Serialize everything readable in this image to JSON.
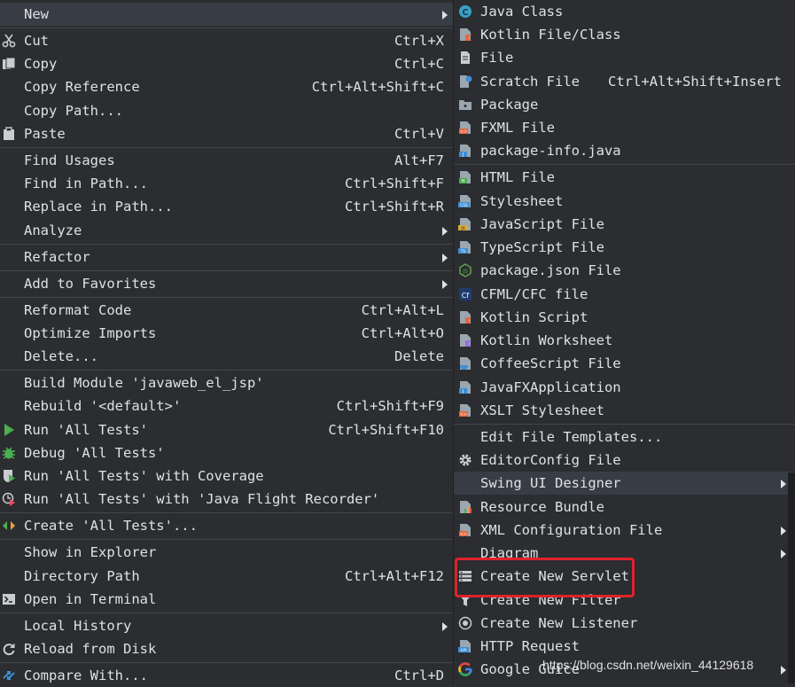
{
  "left_menu": {
    "new": {
      "label": "New"
    },
    "cut": {
      "label": "Cut",
      "shortcut": "Ctrl+X"
    },
    "copy": {
      "label": "Copy",
      "shortcut": "Ctrl+C"
    },
    "copy_reference": {
      "label": "Copy Reference",
      "shortcut": "Ctrl+Alt+Shift+C"
    },
    "copy_path": {
      "label": "Copy Path..."
    },
    "paste": {
      "label": "Paste",
      "shortcut": "Ctrl+V"
    },
    "find_usages": {
      "label": "Find Usages",
      "shortcut": "Alt+F7"
    },
    "find_in_path": {
      "label": "Find in Path...",
      "shortcut": "Ctrl+Shift+F"
    },
    "replace_in_path": {
      "label": "Replace in Path...",
      "shortcut": "Ctrl+Shift+R"
    },
    "analyze": {
      "label": "Analyze"
    },
    "refactor": {
      "label": "Refactor"
    },
    "add_to_favorites": {
      "label": "Add to Favorites"
    },
    "reformat_code": {
      "label": "Reformat Code",
      "shortcut": "Ctrl+Alt+L"
    },
    "optimize_imports": {
      "label": "Optimize Imports",
      "shortcut": "Ctrl+Alt+O"
    },
    "delete": {
      "label": "Delete...",
      "shortcut": "Delete"
    },
    "build_module": {
      "label": "Build Module 'javaweb_el_jsp'"
    },
    "rebuild": {
      "label": "Rebuild '<default>'",
      "shortcut": "Ctrl+Shift+F9"
    },
    "run_tests": {
      "label": "Run 'All Tests'",
      "shortcut": "Ctrl+Shift+F10"
    },
    "debug_tests": {
      "label": "Debug 'All Tests'"
    },
    "run_coverage": {
      "label": "Run 'All Tests' with Coverage"
    },
    "run_jfr": {
      "label": "Run 'All Tests' with 'Java Flight Recorder'"
    },
    "create_tests": {
      "label": "Create 'All Tests'..."
    },
    "show_in_explorer": {
      "label": "Show in Explorer"
    },
    "directory_path": {
      "label": "Directory Path",
      "shortcut": "Ctrl+Alt+F12"
    },
    "open_in_terminal": {
      "label": "Open in Terminal"
    },
    "local_history": {
      "label": "Local History"
    },
    "reload_from_disk": {
      "label": "Reload from Disk"
    },
    "compare_with": {
      "label": "Compare With...",
      "shortcut": "Ctrl+D"
    }
  },
  "right_menu": {
    "java_class": "Java Class",
    "kotlin_file": "Kotlin File/Class",
    "file": "File",
    "scratch_file": {
      "label": "Scratch File",
      "shortcut": "Ctrl+Alt+Shift+Insert"
    },
    "package": "Package",
    "fxml_file": "FXML File",
    "package_info": "package-info.java",
    "html_file": "HTML File",
    "stylesheet": "Stylesheet",
    "javascript_file": "JavaScript File",
    "typescript_file": "TypeScript File",
    "package_json": "package.json File",
    "cfml_file": "CFML/CFC file",
    "kotlin_script": "Kotlin Script",
    "kotlin_worksheet": "Kotlin Worksheet",
    "coffeescript_file": "CoffeeScript File",
    "javafx_app": "JavaFXApplication",
    "xslt_stylesheet": "XSLT Stylesheet",
    "edit_templates": "Edit File Templates...",
    "editorconfig": "EditorConfig File",
    "swing_ui_designer": "Swing UI Designer",
    "resource_bundle": "Resource Bundle",
    "xml_config": "XML Configuration File",
    "diagram": "Diagram",
    "create_servlet": "Create New Servlet",
    "create_filter": "Create New Filter",
    "create_listener": "Create New Listener",
    "http_request": "HTTP Request",
    "google_guice": "Google Guice"
  },
  "watermark": "https://blog.csdn.net/weixin_44129618",
  "colors": {
    "background": "#2b2d30",
    "selected": "#383c44",
    "highlight_box": "#e0222a",
    "text": "#dfe1e5"
  },
  "icons": {
    "cut": "scissors-icon",
    "copy": "copy-icon",
    "paste": "clipboard-icon",
    "run": "run-triangle-icon",
    "debug": "bug-icon",
    "coverage": "shield-run-icon",
    "jfr": "clock-run-icon",
    "create_tests": "diamond-arrows-icon",
    "terminal": "terminal-icon",
    "reload": "refresh-icon",
    "compare": "compare-arrows-icon"
  }
}
